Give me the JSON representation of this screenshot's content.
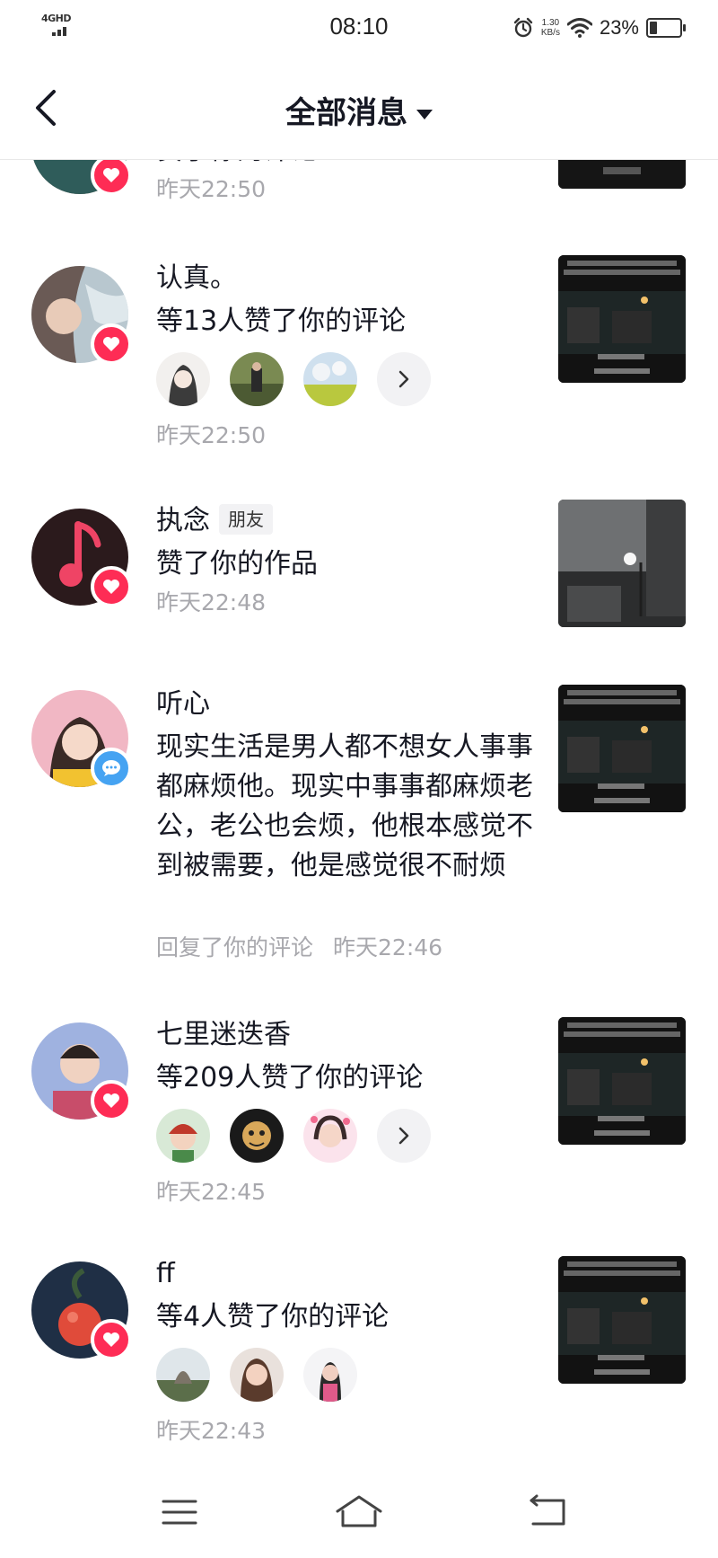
{
  "status_bar": {
    "network": "4GHD",
    "time": "08:10",
    "speed_value": "1.30",
    "speed_unit": "KB/s",
    "battery": "23%",
    "battery_level": 0.23
  },
  "header": {
    "title": "全部消息"
  },
  "messages": [
    {
      "name": "",
      "action": "赞了你的评论",
      "time": "昨天22:50",
      "badge": "like-icon"
    },
    {
      "name": "认真。",
      "action": "等13人赞了你的评论",
      "time": "昨天22:50",
      "badge": "like-icon"
    },
    {
      "name": "执念",
      "tag": "朋友",
      "action": "赞了你的作品",
      "time": "昨天22:48",
      "badge": "like-icon"
    },
    {
      "name": "听心",
      "comment": "现实生活是男人都不想女人事事都麻烦他。现实中事事都麻烦老公，老公也会烦，他根本感觉不到被需要，他是感觉很不耐烦",
      "action": "回复了你的评论",
      "time": "昨天22:46",
      "badge": "comment-icon"
    },
    {
      "name": "七里迷迭香",
      "action": "等209人赞了你的评论",
      "time": "昨天22:45",
      "badge": "like-icon"
    },
    {
      "name": "ff",
      "action": "等4人赞了你的评论",
      "time": "昨天22:43",
      "badge": "like-icon"
    }
  ],
  "colors": {
    "like": "#fe2c55",
    "comment": "#45a3f2",
    "time_text": "#a8a8ad"
  }
}
